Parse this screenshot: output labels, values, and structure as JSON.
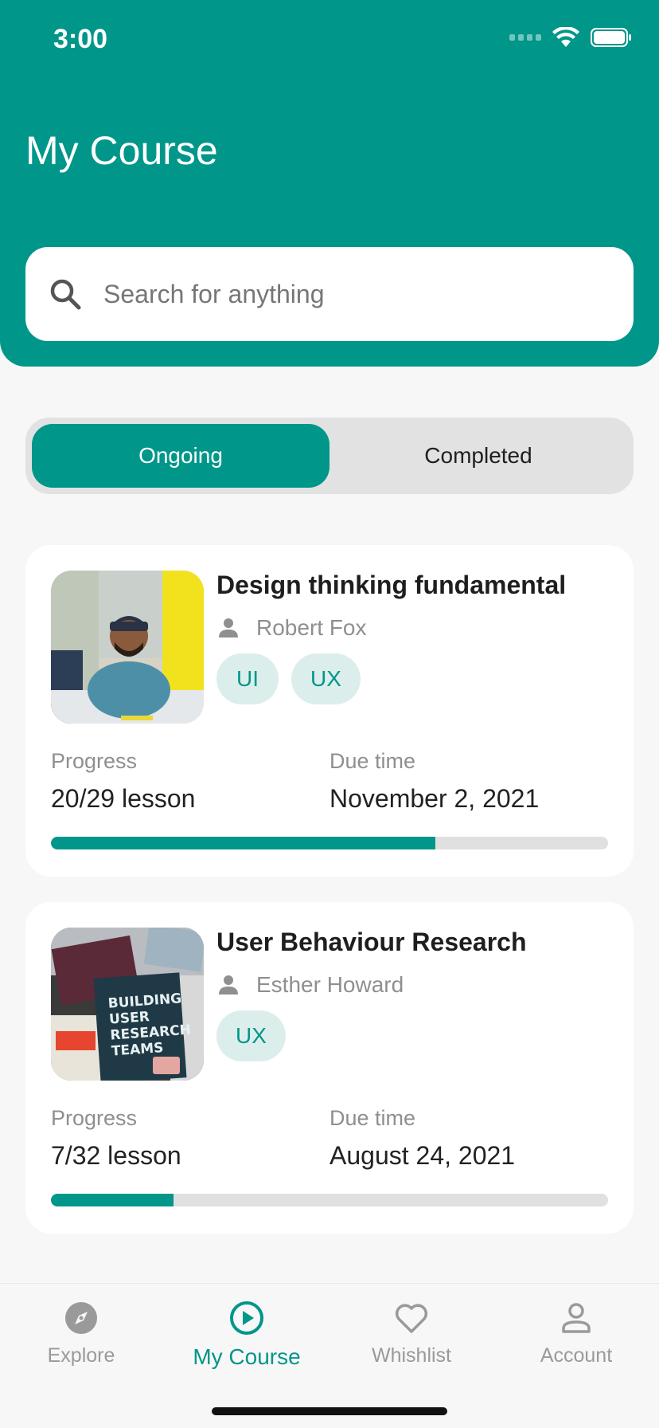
{
  "status_bar": {
    "time": "3:00"
  },
  "header": {
    "title": "My Course"
  },
  "search": {
    "placeholder": "Search for anything"
  },
  "tabs": {
    "ongoing": "Ongoing",
    "completed": "Completed",
    "selected": "Ongoing"
  },
  "courses": [
    {
      "title": "Design thinking fundamental",
      "author": "Robert Fox",
      "tags": [
        "UI",
        "UX"
      ],
      "progress_label": "Progress",
      "progress_value": "20/29 lesson",
      "progress_fraction": 0.69,
      "due_label": "Due time",
      "due_value": "November 2, 2021"
    },
    {
      "title": "User Behaviour Research",
      "author": "Esther Howard",
      "tags": [
        "UX"
      ],
      "progress_label": "Progress",
      "progress_value": "7/32 lesson",
      "progress_fraction": 0.22,
      "due_label": "Due time",
      "due_value": "August 24, 2021"
    }
  ],
  "nav": {
    "explore": "Explore",
    "my_course": "My Course",
    "whishlist": "Whishlist",
    "account": "Account",
    "active": "My Course"
  },
  "colors": {
    "primary": "#00968A",
    "tag_bg": "#DCEEEC"
  }
}
